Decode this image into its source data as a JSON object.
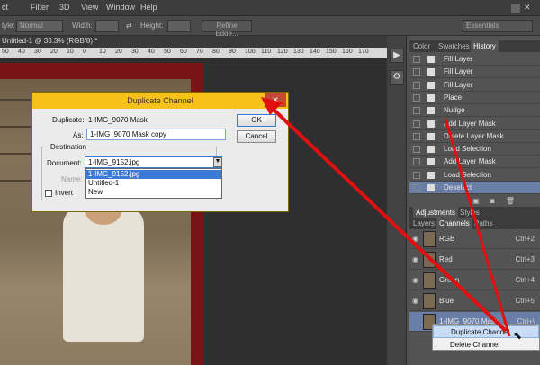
{
  "menubar": {
    "items": [
      "ct",
      "Filter",
      "3D",
      "View",
      "Window",
      "Help"
    ]
  },
  "options": {
    "style_label": "tyle:",
    "style_value": "Normal",
    "width_label": "Width:",
    "height_label": "Height:",
    "refine_button": "Refine Edge...",
    "workspace": "Essentials"
  },
  "document": {
    "tab": "Untitled-1 @ 33.3% (RGB/8) *",
    "ruler_ticks": [
      "50",
      "40",
      "30",
      "20",
      "10",
      "0",
      "10",
      "20",
      "30",
      "40",
      "50",
      "60",
      "70",
      "80",
      "90",
      "100",
      "110",
      "120",
      "130",
      "140",
      "150",
      "160",
      "170"
    ]
  },
  "panel": {
    "top_tabs": [
      "Color",
      "Swatches",
      "History"
    ],
    "history": [
      "Fill Layer",
      "Fill Layer",
      "Fill Layer",
      "Place",
      "Nudge",
      "Add Layer Mask",
      "Delete Layer Mask",
      "Load Selection",
      "Add Layer Mask",
      "Load Selection",
      "Deselect"
    ],
    "adj_tabs": [
      "Adjustments",
      "Styles"
    ],
    "layer_tabs": [
      "Layers",
      "Channels",
      "Paths"
    ],
    "channels": [
      {
        "name": "RGB",
        "shortcut": "Ctrl+2"
      },
      {
        "name": "Red",
        "shortcut": "Ctrl+3"
      },
      {
        "name": "Green",
        "shortcut": "Ctrl+4"
      },
      {
        "name": "Blue",
        "shortcut": "Ctrl+5"
      },
      {
        "name": "1-IMG_9070 Mask",
        "shortcut": "Ctrl+\\"
      }
    ]
  },
  "context_menu": {
    "items": [
      "Duplicate Channel...",
      "Delete Channel"
    ]
  },
  "dialog": {
    "title": "Duplicate Channel",
    "duplicate_label": "Duplicate:",
    "duplicate_value": "1-IMG_9070 Mask",
    "as_label": "As:",
    "as_value": "1-IMG_9070 Mask copy",
    "destination_label": "Destination",
    "document_label": "Document:",
    "document_value": "1-IMG_9152.jpg",
    "name_label": "Name:",
    "invert_label": "Invert",
    "ok": "OK",
    "cancel": "Cancel",
    "dropdown_options": [
      "1-IMG_9152.jpg",
      "Untitled-1",
      "New"
    ]
  },
  "colors": {
    "highlight": "#6a7fa8",
    "dialog_title": "#f5c11a",
    "arrow": "#e01010"
  }
}
